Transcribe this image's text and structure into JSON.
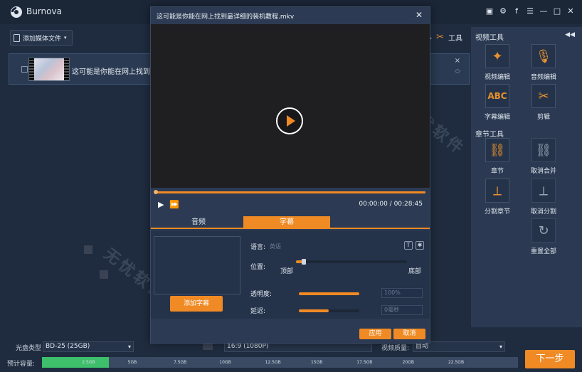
{
  "app": {
    "name": "Burnova"
  },
  "window_controls": [
    "▣",
    "⚙",
    "f",
    "☰",
    "—",
    "□",
    "✕"
  ],
  "toolbar": {
    "add_media": "添加媒体文件",
    "tools_label": "工具",
    "partial_left": "多"
  },
  "file": {
    "name": "这可能是你能在网上找到最详",
    "extra": "冊",
    "close": "×"
  },
  "side_panel": {
    "video_tools_title": "视频工具",
    "chapter_tools_title": "章节工具",
    "video_tools": [
      {
        "label": "视频编辑",
        "icon": "magic-wand-icon"
      },
      {
        "label": "音频编辑",
        "icon": "microphone-icon"
      },
      {
        "label": "字幕编辑",
        "icon": "abc-icon",
        "glyph": "ABC"
      },
      {
        "label": "剪辑",
        "icon": "scissors-icon"
      }
    ],
    "chapter_tools": [
      {
        "label": "章节",
        "icon": "link-icon"
      },
      {
        "label": "取消合并",
        "icon": "unlink-icon"
      },
      {
        "label": "分割章节",
        "icon": "split-icon"
      },
      {
        "label": "取消分割",
        "icon": "cancel-split-icon"
      },
      {
        "label": "重置全部",
        "icon": "reset-icon"
      }
    ]
  },
  "dialog": {
    "title": "这可能是你能在网上找到最详细的装机教程.mkv",
    "time": "00:00:00 / 00:28:45",
    "tabs": [
      {
        "label": "音频"
      },
      {
        "label": "字幕"
      }
    ],
    "active_tab": "字幕",
    "language_label": "语言:",
    "language_value": "英语",
    "position_label": "位置:",
    "position_top": "顶部",
    "position_bottom": "底部",
    "opacity_label": "透明度:",
    "opacity_value": "100%",
    "opacity_level": 1.0,
    "delay_label": "延迟:",
    "delay_value": "0毫秒",
    "add_subtitle": "添加字幕",
    "ok": "应用",
    "cancel": "取消"
  },
  "bottom": {
    "disc_type_label": "光盘类型",
    "disc_type_value": "BD-25 (25GB)",
    "resolution_value": "16:9 (1080P)",
    "quality_label": "视频质量:",
    "quality_value": "自动",
    "capacity_label": "预计容量:",
    "capacity_ticks": [
      "2.5GB",
      "5GB",
      "7.5GB",
      "10GB",
      "12.5GB",
      "15GB",
      "17.5GB",
      "20GB",
      "22.5GB"
    ],
    "capacity_fill_fraction": 0.14,
    "next": "下一步"
  },
  "watermark": "无忧软件",
  "colors": {
    "accent": "#f08a24",
    "panel": "#2b3a52",
    "background": "#1f2c3f",
    "capacity": "#3dbf6b"
  }
}
